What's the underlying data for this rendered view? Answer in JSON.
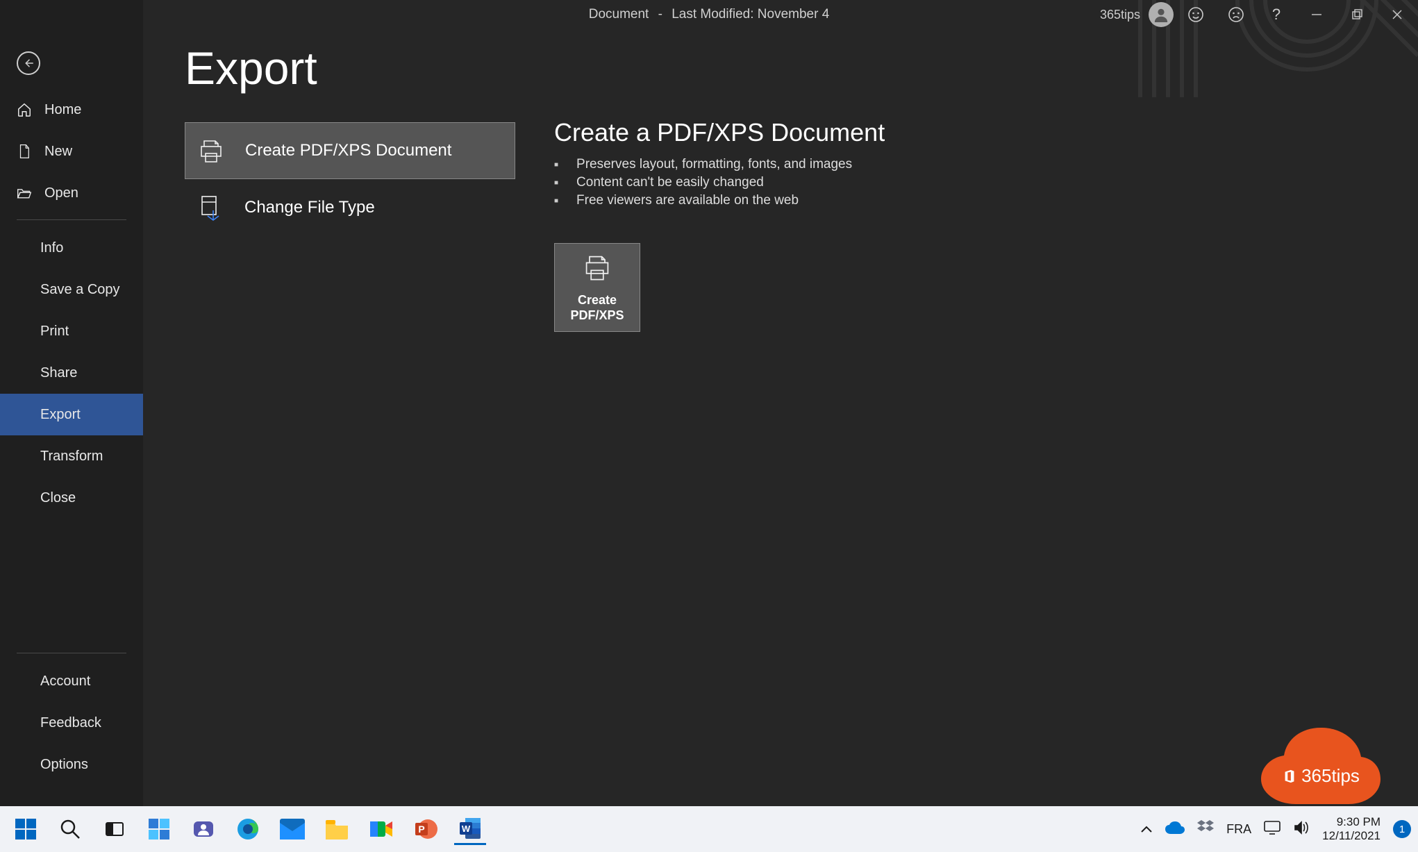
{
  "titlebar": {
    "doc": "Document",
    "sep": "-",
    "modified": "Last Modified: November 4",
    "account": "365tips"
  },
  "sidebar": {
    "home": "Home",
    "new": "New",
    "open": "Open",
    "info": "Info",
    "save_copy": "Save a Copy",
    "print": "Print",
    "share": "Share",
    "export": "Export",
    "transform": "Transform",
    "close": "Close",
    "account": "Account",
    "feedback": "Feedback",
    "options": "Options"
  },
  "main": {
    "title": "Export",
    "options": [
      {
        "label": "Create PDF/XPS Document"
      },
      {
        "label": "Change File Type"
      }
    ],
    "detail": {
      "title": "Create a PDF/XPS Document",
      "bullets": [
        "Preserves layout, formatting, fonts, and images",
        "Content can't be easily changed",
        "Free viewers are available on the web"
      ],
      "big_button": "Create\nPDF/XPS"
    }
  },
  "branding": {
    "cloud_text": "365tips"
  },
  "taskbar": {
    "lang": "FRA",
    "time": "9:30 PM",
    "date": "12/11/2021",
    "notifications": "1"
  }
}
